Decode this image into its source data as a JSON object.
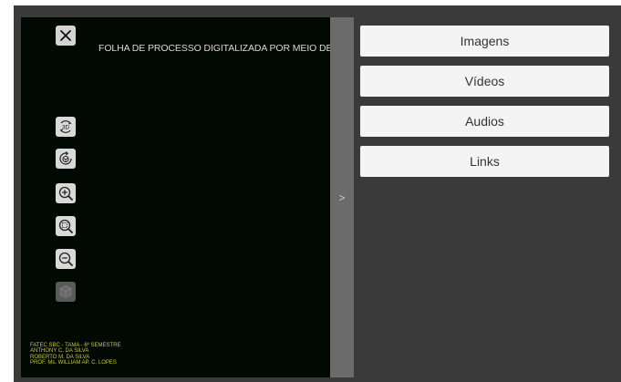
{
  "viewer": {
    "title": "FOLHA DE PROCESSO DIGITALIZADA POR MEIO DE APLICAÇÃO",
    "close_icon": "close-icon",
    "tools": [
      {
        "name": "rotate-3d-icon",
        "label": "3D"
      },
      {
        "name": "reset-view-icon"
      },
      {
        "name": "zoom-in-icon"
      },
      {
        "name": "zoom-fit-icon"
      },
      {
        "name": "zoom-out-icon"
      },
      {
        "name": "cube-icon",
        "disabled": true
      }
    ],
    "credits": [
      "FATEC SBC - TAMA - 6º SEMESTRE",
      "ANTHONY C. DA SILVA",
      "ROBERTO M. DA SILVA",
      "PROF. Ms. WILLIAM AP. C. LOPES"
    ]
  },
  "collapse": {
    "label": ">"
  },
  "side_menu": {
    "items": [
      "Imagens",
      "Vídeos",
      "Audios",
      "Links"
    ]
  },
  "colors": {
    "frame": "#3a3a3a",
    "viewer_bg": "#020802",
    "credits": "#c7c742",
    "button_bg": "#f4f4f4"
  }
}
